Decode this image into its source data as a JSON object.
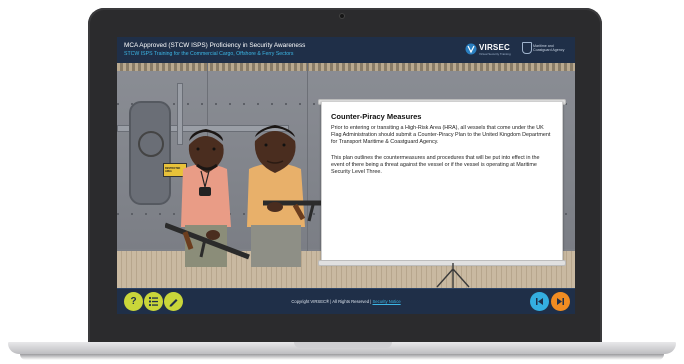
{
  "header": {
    "title": "MCA Approved (STCW ISPS) Proficiency in Security Awareness",
    "subtitle": "STCW ISPS Training for the Commercial Cargo, Offshore & Ferry Sectors",
    "logo_virsec": "VIRSEC",
    "logo_virsec_tagline": "Virtual Security Training",
    "logo_mca_text": "Maritime and Coastguard Agency"
  },
  "scene": {
    "sign_text": "RESTRICTED AREA"
  },
  "board": {
    "heading": "Counter-Piracy Measures",
    "paragraph1": "Prior to entering or transiting a High-Risk Area (HRA), all vessels that come under the UK Flag Administration should submit a Counter-Piracy Plan to the United Kingdom Department for Transport Maritime & Coastguard Agency.",
    "paragraph2": "This plan outlines the countermeasures and procedures that will be put into effect in the event of there being a threat against the vessel or if the vessel is operating at Maritime Security Level Three."
  },
  "footer": {
    "help_label": "?",
    "copyright_prefix": "Copyright VIRSEC® | All Rights Reserved |",
    "copyright_link": "Security Notice",
    "prev_label": "|◀",
    "next_label": "▶|"
  },
  "colors": {
    "header_bg": "#1f2f48",
    "accent_blue": "#3cb7e6",
    "button_yellow": "#c9d63a",
    "button_prev": "#34aee0",
    "button_next": "#f08c22"
  }
}
